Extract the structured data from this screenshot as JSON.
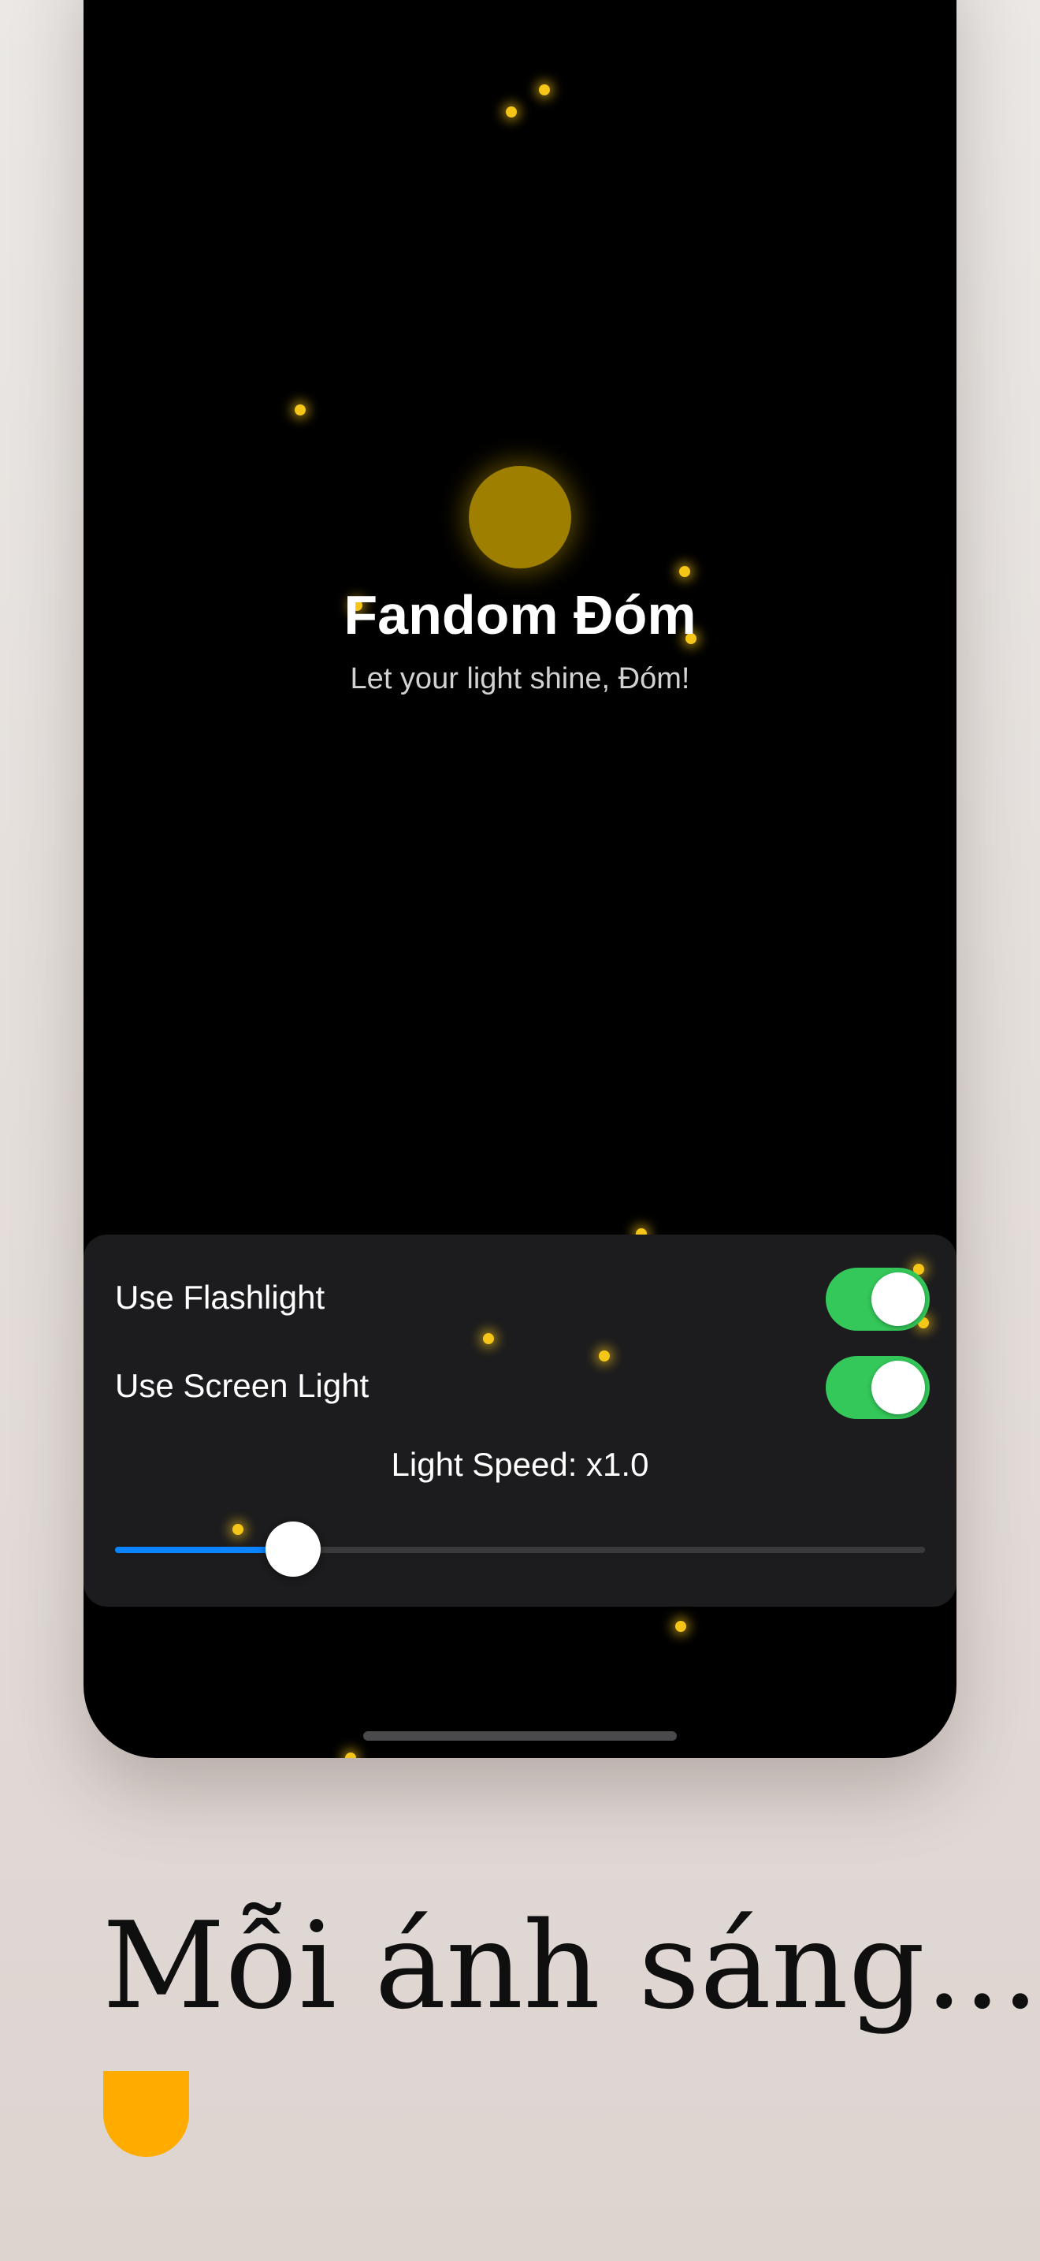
{
  "app": {
    "title": "Fandom Đóm",
    "subtitle": "Let your light shine, Đóm!"
  },
  "settings": {
    "flashlight": {
      "label": "Use Flashlight",
      "enabled": true
    },
    "screen_light": {
      "label": "Use Screen Light",
      "enabled": true
    },
    "speed_label": "Light Speed: x1.0",
    "slider_fraction": 0.22
  },
  "colors": {
    "firefly": "#f5c518",
    "orb": "#9f7f00",
    "toggle_on": "#34c759",
    "slider_fill": "#0a84ff",
    "accent_badge": "#ffab00"
  },
  "promo": {
    "headline": "Mỗi ánh sáng..."
  }
}
